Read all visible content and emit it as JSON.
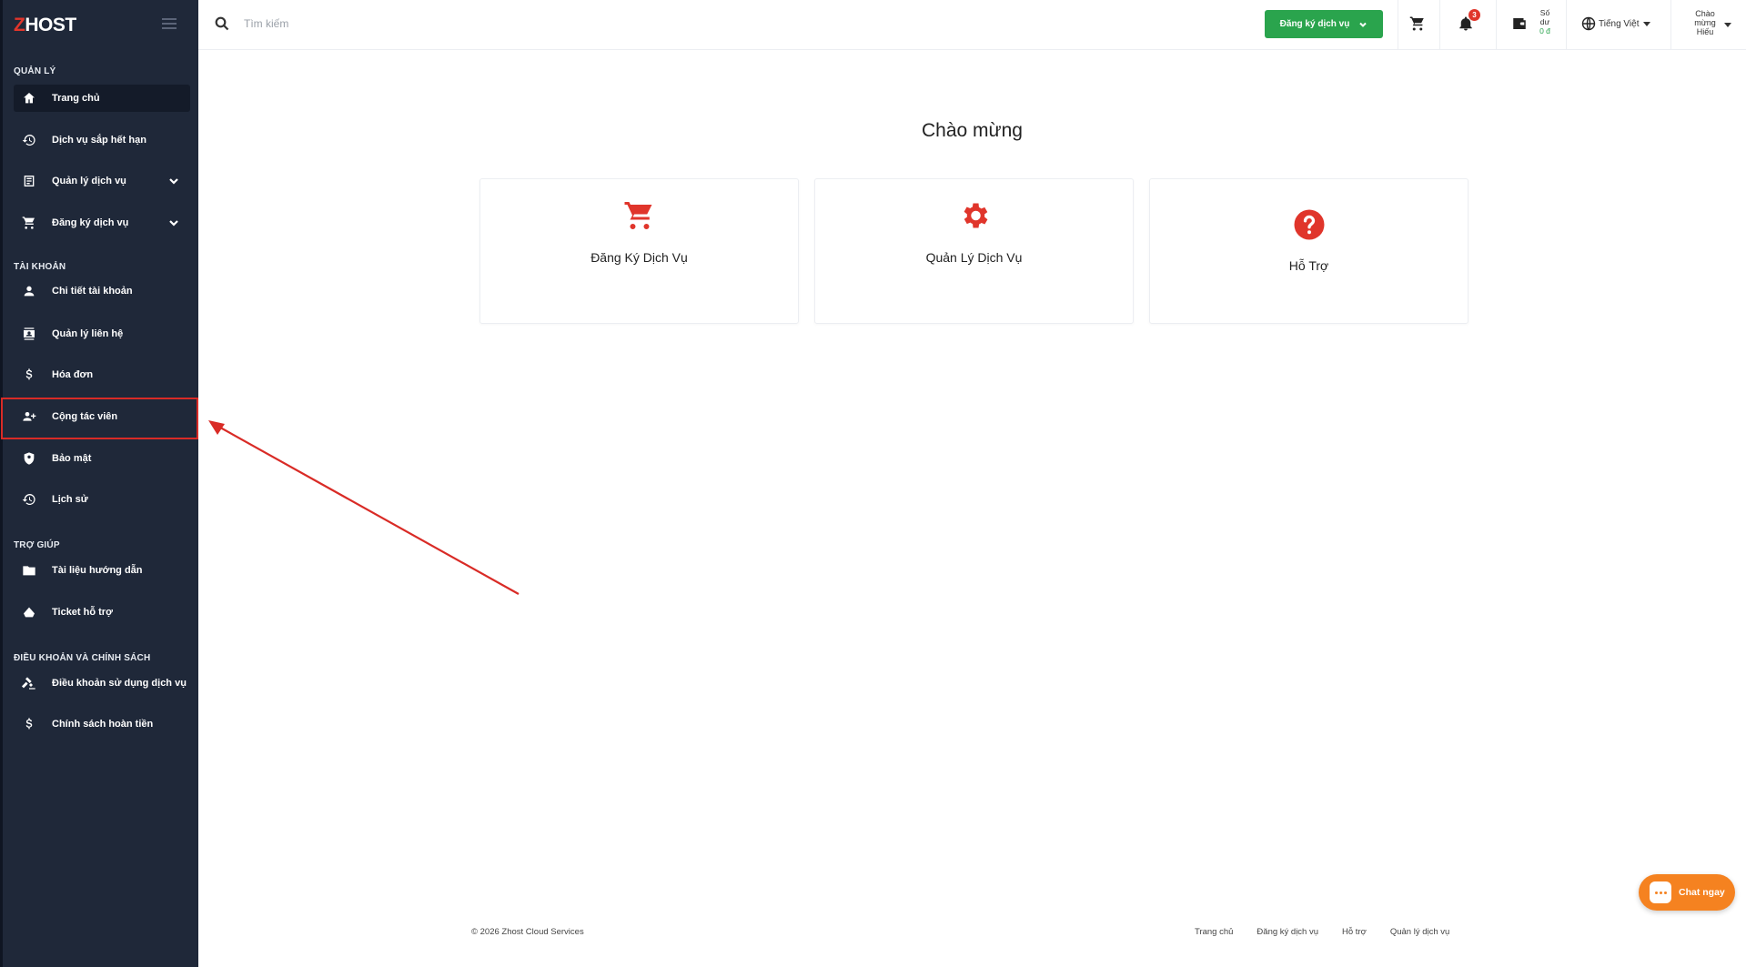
{
  "brand": {
    "logo_z": "Z",
    "logo_rest": "HOST"
  },
  "sidebar": {
    "sections": [
      {
        "title": "QUẢN LÝ"
      },
      {
        "title": "TÀI KHOẢN"
      },
      {
        "title": "TRỢ GIÚP"
      },
      {
        "title": "ĐIỀU KHOẢN VÀ CHÍNH SÁCH"
      }
    ],
    "items": [
      {
        "label": "Trang chủ",
        "icon": "home-icon"
      },
      {
        "label": "Dịch vụ sắp hết hạn",
        "icon": "history-icon"
      },
      {
        "label": "Quản lý dịch vụ",
        "icon": "list-box-icon"
      },
      {
        "label": "Đăng ký dịch vụ",
        "icon": "cart-icon"
      },
      {
        "label": "Chi tiết tài khoản",
        "icon": "user-icon"
      },
      {
        "label": "Quản lý liên hệ",
        "icon": "contact-card-icon"
      },
      {
        "label": "Hóa đơn",
        "icon": "dollar-icon"
      },
      {
        "label": "Cộng tác viên",
        "icon": "add-users-icon"
      },
      {
        "label": "Bảo mật",
        "icon": "shield-icon"
      },
      {
        "label": "Lịch sử",
        "icon": "history-icon"
      },
      {
        "label": "Tài liệu hướng dẫn",
        "icon": "folder-icon"
      },
      {
        "label": "Ticket hỗ trợ",
        "icon": "ticket-icon"
      },
      {
        "label": "Điều khoản sử dụng dịch vụ",
        "icon": "gavel-icon"
      },
      {
        "label": "Chính sách hoàn tiền",
        "icon": "dollar-icon"
      }
    ]
  },
  "topbar": {
    "search_placeholder": "Tìm kiếm",
    "register_label": "Đăng ký dịch vụ",
    "notification_count": "3",
    "balance_line1": "Số",
    "balance_line2": "dư",
    "balance_amount": "0 đ",
    "language": "Tiếng Việt",
    "greeting_line1": "Chào",
    "greeting_line2": "mừng",
    "greeting_line3": "Hiếu"
  },
  "main": {
    "welcome": "Chào mừng",
    "cards": [
      {
        "label": "Đăng Ký Dịch Vụ",
        "icon": "cart-icon"
      },
      {
        "label": "Quản Lý Dịch Vụ",
        "icon": "gear-icon"
      },
      {
        "label": "Hỗ Trợ",
        "icon": "question-icon"
      }
    ]
  },
  "footer": {
    "copyright": "© 2026 Zhost Cloud Services",
    "links": [
      "Trang chủ",
      "Đăng ký dịch vụ",
      "Hỗ trợ",
      "Quản lý dịch vụ"
    ]
  },
  "chat": {
    "label": "Chat ngay"
  },
  "colors": {
    "sidebar_bg": "#1f2839",
    "accent_red": "#e0352b",
    "register_green": "#2aa44d",
    "chat_orange": "#f58220"
  }
}
